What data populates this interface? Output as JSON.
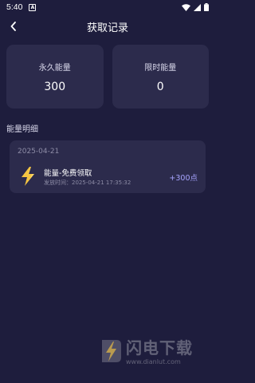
{
  "status_bar": {
    "time": "5:40",
    "notif_letter": "A"
  },
  "header": {
    "title": "获取记录"
  },
  "cards": [
    {
      "label": "永久能量",
      "value": "300"
    },
    {
      "label": "限时能量",
      "value": "0"
    }
  ],
  "section": {
    "title": "能量明细"
  },
  "records": [
    {
      "date": "2025-04-21",
      "name": "能量-免费领取",
      "time": "发放时间：2025-04-21 17:35:32",
      "points": "+300点"
    }
  ],
  "watermark": {
    "text": "闪电下载",
    "url": "www.dianlut.com"
  },
  "colors": {
    "background": "#1e1d3d",
    "card": "#2c2b4c",
    "accent": "#a7a4ff",
    "bolt": "#f5c542"
  }
}
